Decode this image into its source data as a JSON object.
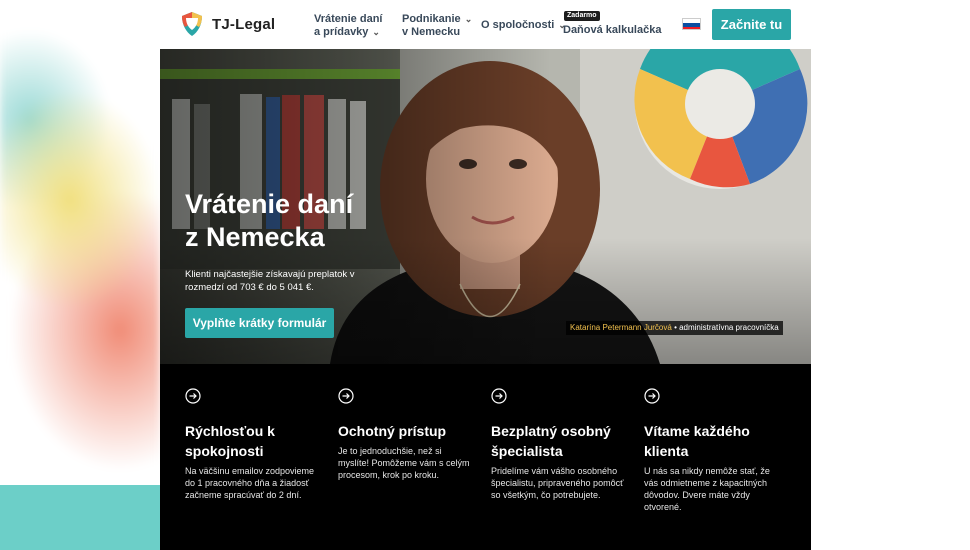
{
  "header": {
    "logo_text": "TJ-Legal",
    "nav": [
      {
        "line1": "Vrátenie daní",
        "line2": "a prídavky"
      },
      {
        "line1": "Podnikanie",
        "line2": "v Nemecku"
      },
      {
        "line1": "O spoločnosti"
      },
      {
        "line1": "Daňová kalkulačka",
        "badge": "Zadarmo"
      }
    ],
    "cta_label": "Začnite tu",
    "flag": "slovak-flag-icon"
  },
  "hero": {
    "title_line1": "Vrátenie daní",
    "title_line2": "z Nemecka",
    "subtitle": "Klienti najčastejšie získavajú preplatok v rozmedzí od 703 € do 5 041 €.",
    "button_label": "Vyplňte krátky formulár",
    "caption_name": "Katarína Petermann Jurčová",
    "caption_role": " • administratívna pracovníčka"
  },
  "features": [
    {
      "icon": "arrow-right-circle-icon",
      "title": "Rýchlosťou k spokojnosti",
      "text": "Na väčšinu emailov zodpovieme do 1 pracovného dňa a žiadosť začneme spracúvať do 2 dní."
    },
    {
      "icon": "arrow-right-circle-icon",
      "title": "Ochotný prístup",
      "text": "Je to jednoduchšie, než si myslíte! Pomôžeme vám s celým procesom, krok po kroku."
    },
    {
      "icon": "arrow-right-circle-icon",
      "title": "Bezplatný osobný špecialista",
      "text": "Pridelíme vám vášho osobného špecialistu, pripraveného pomôcť so všetkým, čo potrebujete."
    },
    {
      "icon": "arrow-right-circle-icon",
      "title": "Vítame každého klienta",
      "text": "U nás sa nikdy nemôže stať, že vás odmietneme z kapacitných dôvodov. Dvere máte vždy otvorené."
    }
  ],
  "colors": {
    "accent": "#2aa6a7",
    "header_bg": "#ffffff",
    "features_bg": "#000000",
    "caption_name": "#f2c14e"
  }
}
